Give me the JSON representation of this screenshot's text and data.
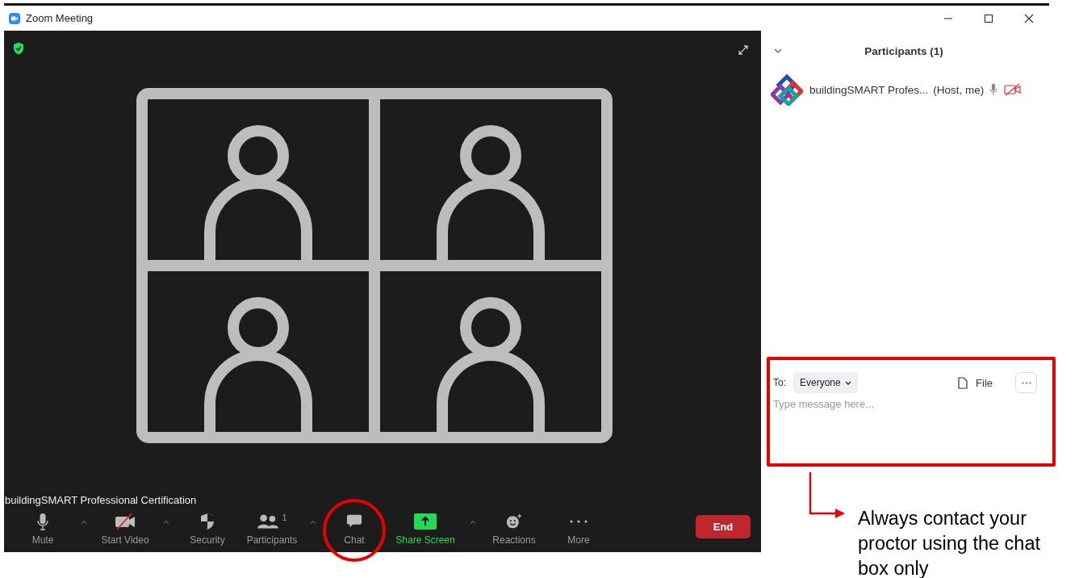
{
  "window": {
    "title": "Zoom Meeting"
  },
  "video": {
    "name_label": "buildingSMART Professional Certification"
  },
  "toolbar": [
    {
      "kind": "mic",
      "label": "Mute",
      "caret": true,
      "circled": false
    },
    {
      "kind": "video",
      "label": "Start Video",
      "caret": true,
      "circled": false
    },
    {
      "kind": "security",
      "label": "Security",
      "caret": false,
      "circled": false
    },
    {
      "kind": "participants",
      "label": "Participants",
      "count": "1",
      "caret": true,
      "circled": false
    },
    {
      "kind": "chat",
      "label": "Chat",
      "caret": false,
      "circled": true
    },
    {
      "kind": "share",
      "label": "Share Screen",
      "caret": true,
      "circled": false
    },
    {
      "kind": "reactions",
      "label": "Reactions",
      "caret": false,
      "circled": false
    },
    {
      "kind": "more",
      "label": "More",
      "caret": false,
      "circled": false
    }
  ],
  "end_button": "End",
  "participants_panel": {
    "title": "Participants (1)",
    "participants": [
      {
        "name": "buildingSMART Profes...",
        "role": "(Host, me)",
        "camera_on": false
      }
    ]
  },
  "chat": {
    "to_label": "To:",
    "recipient": "Everyone",
    "file_label": "File",
    "placeholder": "Type message here..."
  },
  "callout": {
    "text": "Always contact your proctor using the chat box only"
  }
}
